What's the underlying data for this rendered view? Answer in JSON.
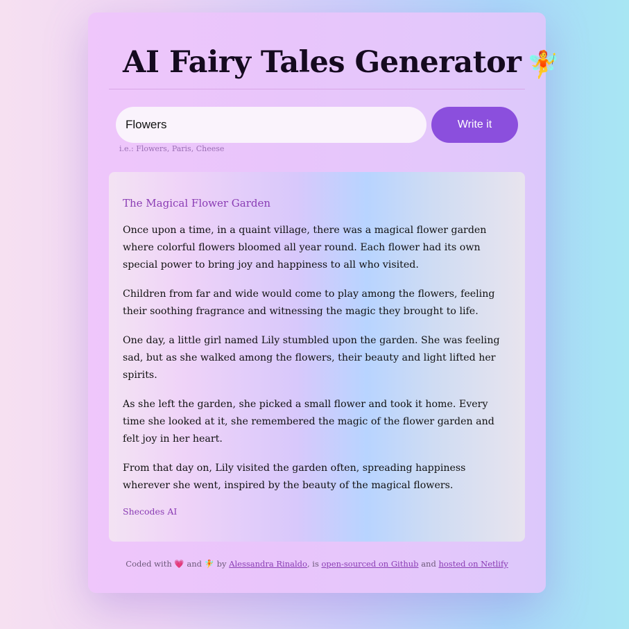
{
  "header": {
    "title": "AI Fairy Tales Generator",
    "title_icon": "🧚"
  },
  "search": {
    "value": "Flowers",
    "hint": "i.e.: Flowers, Paris, Cheese",
    "button_label": "Write it"
  },
  "story": {
    "title": "The Magical Flower Garden",
    "paragraphs": [
      "Once upon a time, in a quaint village, there was a magical flower garden where colorful flowers bloomed all year round. Each flower had its own special power to bring joy and happiness to all who visited.",
      "Children from far and wide would come to play among the flowers, feeling their soothing fragrance and witnessing the magic they brought to life.",
      "One day, a little girl named Lily stumbled upon the garden. She was feeling sad, but as she walked among the flowers, their beauty and light lifted her spirits.",
      "As she left the garden, she picked a small flower and took it home. Every time she looked at it, she remembered the magic of the flower garden and felt joy in her heart.",
      "From that day on, Lily visited the garden often, spreading happiness wherever she went, inspired by the beauty of the magical flowers."
    ],
    "signature": "Shecodes AI"
  },
  "footer": {
    "coded_with": "Coded with",
    "heart_icon": "💗",
    "and_1": "and",
    "fairy_icon": "🧚",
    "by": "by",
    "author_link": "Alessandra Rinaldo",
    "is": ", is",
    "github_link": "open-sourced on Github",
    "and_2": "and",
    "netlify_link": "hosted on Netlify"
  },
  "colors": {
    "accent": "#8b4fdd",
    "story_title": "#8a3cb4",
    "link": "#8a3cb4"
  }
}
